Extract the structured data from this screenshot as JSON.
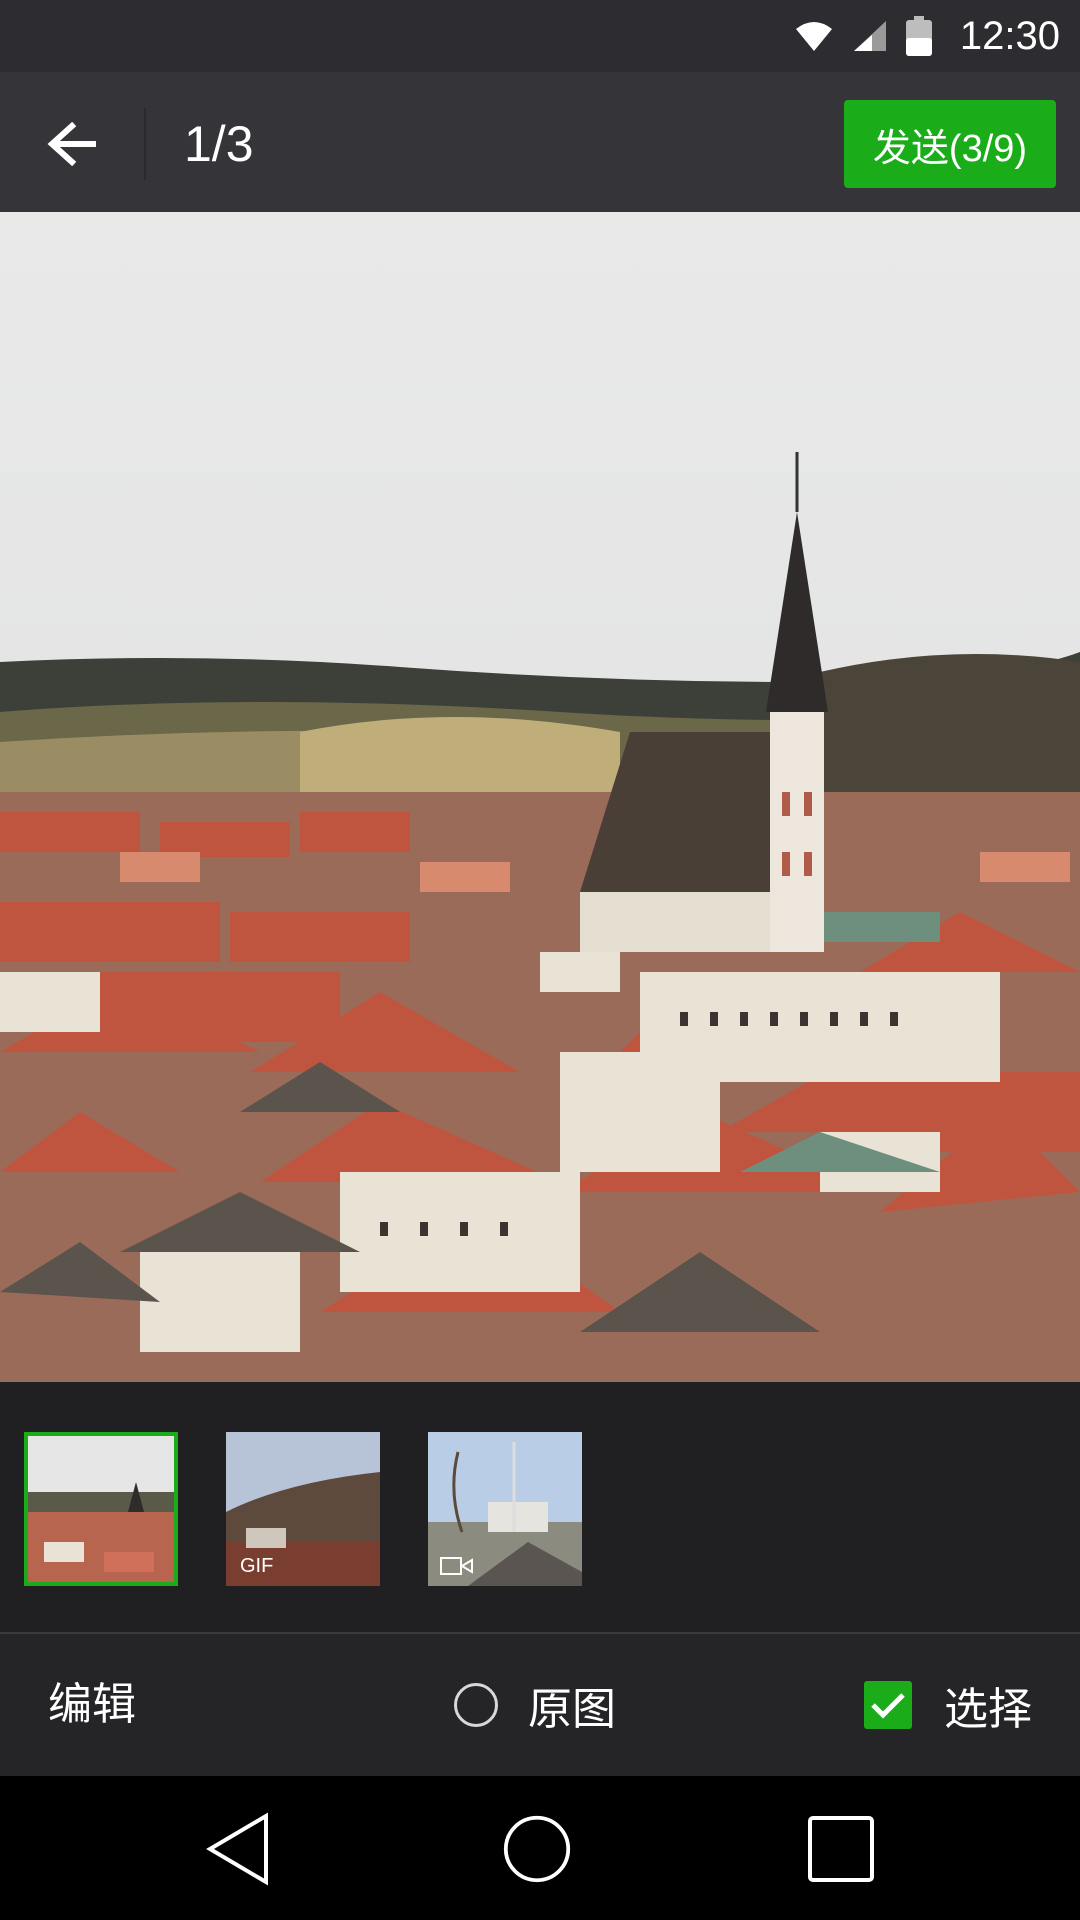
{
  "status_bar": {
    "time": "12:30",
    "icons": [
      "wifi-icon",
      "cell-signal-icon",
      "battery-icon"
    ]
  },
  "toolbar": {
    "back_icon": "arrow-left-icon",
    "page_counter": "1/3",
    "send_label": "发送(3/9)"
  },
  "thumbnails": [
    {
      "kind": "image",
      "badge": "",
      "selected": true
    },
    {
      "kind": "gif",
      "badge": "GIF",
      "selected": false
    },
    {
      "kind": "video",
      "badge": "video-icon",
      "selected": false
    }
  ],
  "bottom_bar": {
    "edit_label": "编辑",
    "original_label": "原图",
    "original_checked": false,
    "select_label": "选择",
    "select_checked": true
  },
  "nav_bar": {
    "icons": [
      "back-triangle-icon",
      "home-circle-icon",
      "recents-square-icon"
    ]
  },
  "colors": {
    "accent": "#1aad19",
    "toolbar_bg": "#353438",
    "status_bg": "#2d2c30"
  }
}
